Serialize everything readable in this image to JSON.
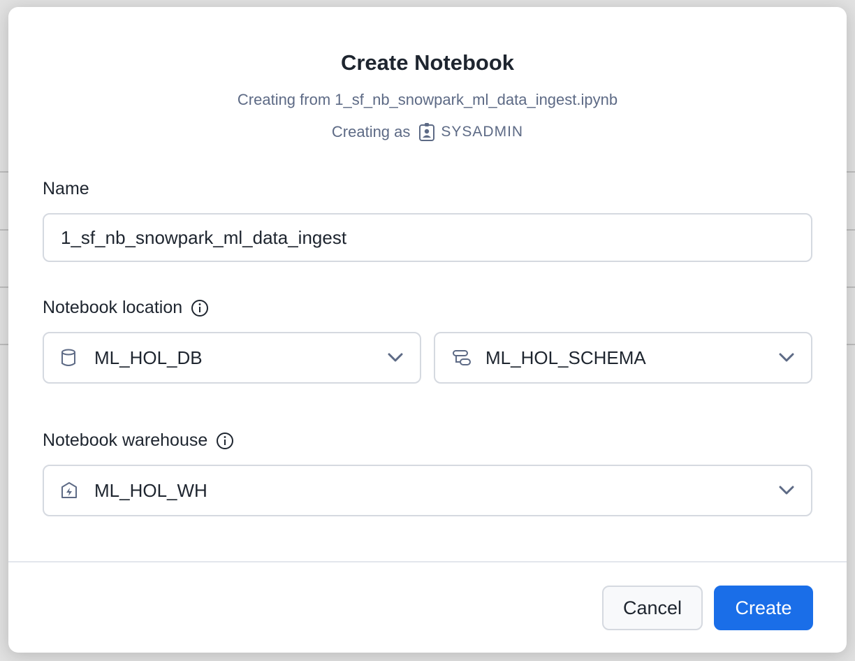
{
  "dialog": {
    "title": "Create Notebook",
    "subtitle": "Creating from 1_sf_nb_snowpark_ml_data_ingest.ipynb",
    "creating_as_label": "Creating as",
    "role": "SYSADMIN"
  },
  "name_field": {
    "label": "Name",
    "value": "1_sf_nb_snowpark_ml_data_ingest"
  },
  "location": {
    "label": "Notebook location",
    "database": "ML_HOL_DB",
    "schema": "ML_HOL_SCHEMA"
  },
  "warehouse": {
    "label": "Notebook warehouse",
    "value": "ML_HOL_WH"
  },
  "actions": {
    "cancel": "Cancel",
    "create": "Create"
  },
  "icons": {
    "role": "user-badge-icon",
    "info": "info-icon",
    "database": "database-icon",
    "schema": "schema-icon",
    "warehouse": "warehouse-icon",
    "dropdown": "chevron-down-icon"
  },
  "colors": {
    "primary": "#1a6ee8",
    "muted_text": "#5d6a85",
    "text": "#1e252f",
    "border": "#d5d9e0"
  }
}
